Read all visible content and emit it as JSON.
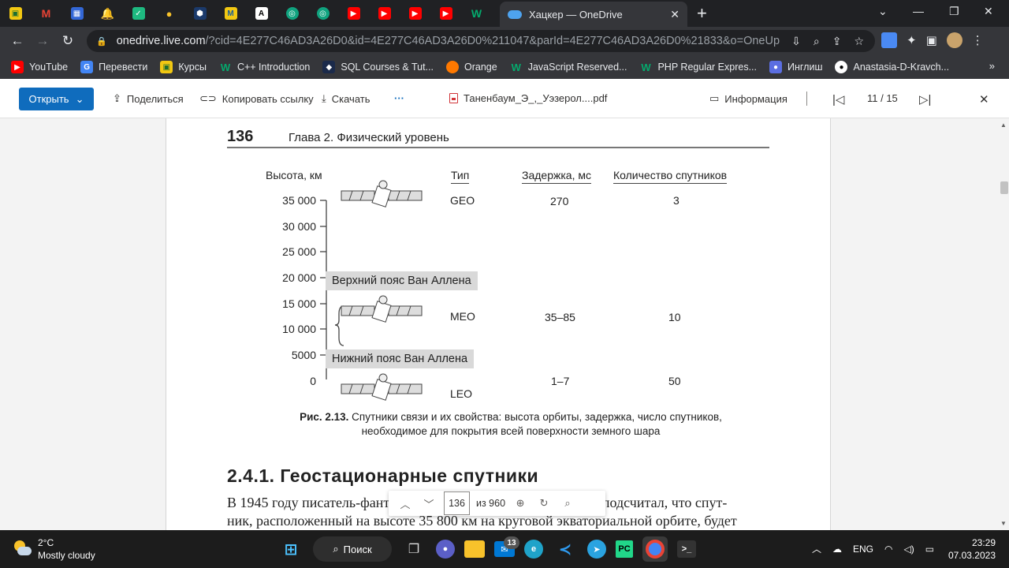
{
  "browser": {
    "active_tab_title": "Хацкер — OneDrive",
    "url_host": "onedrive.live.com",
    "url_path": "/?cid=4E277C46AD3A26D0&id=4E277C46AD3A26D0%211047&parId=4E277C46AD3A26D0%21833&o=OneUp",
    "bookmarks": [
      {
        "label": "YouTube",
        "color": "#ff0000"
      },
      {
        "label": "Перевести",
        "color": "#4285f4"
      },
      {
        "label": "Курсы",
        "color": "#f2c812"
      },
      {
        "label": "C++ Introduction",
        "color": "#04aa6d"
      },
      {
        "label": "SQL Courses & Tut...",
        "color": "#1b2a4a"
      },
      {
        "label": "Orange",
        "color": "#ff7900"
      },
      {
        "label": "JavaScript Reserved...",
        "color": "#04aa6d"
      },
      {
        "label": "PHP Regular Expres...",
        "color": "#04aa6d"
      },
      {
        "label": "Инглиш",
        "color": "#5b6ee1"
      },
      {
        "label": "Anastasia-D-Kravch...",
        "color": "#ffffff"
      }
    ],
    "bookmarks_more": "»"
  },
  "onedrive": {
    "open_label": "Открыть",
    "share_label": "Поделиться",
    "copy_link_label": "Копировать ссылку",
    "download_label": "Скачать",
    "more_label": "···",
    "file_name": "Таненбаум_Э_,_Уэзерол....pdf",
    "info_label": "Информация",
    "page_counter": "11 / 15"
  },
  "pdf": {
    "page_number": "136",
    "running_head": "Глава 2. Физический уровень",
    "figure": {
      "altitude_header": "Высота, км",
      "type_header": "Тип",
      "delay_header": "Задержка, мс",
      "count_header": "Количество спутников",
      "altitude_ticks": [
        "35 000",
        "30 000",
        "25 000",
        "20 000",
        "15 000",
        "10 000",
        "5000",
        "0"
      ],
      "upper_belt": "Верхний пояс Ван Аллена",
      "lower_belt": "Нижний пояс Ван Аллена",
      "rows": [
        {
          "type": "GEO",
          "delay": "270",
          "count": "3"
        },
        {
          "type": "MEO",
          "delay": "35–85",
          "count": "10"
        },
        {
          "type": "LEO",
          "delay": "1–7",
          "count": "50"
        }
      ]
    },
    "caption_prefix": "Рис. 2.13.",
    "caption_line1": "Спутники связи и их свойства: высота орбиты, задержка, число спутников,",
    "caption_line2": "необходимое для покрытия всей поверхности земного шара",
    "section_title": "2.4.1. Геостационарные спутники",
    "body_line1": "В 1945 году писатель-фантаст Артур Кларк (Arthur C. Clarke) подсчитал, что спут-",
    "body_line2": "ник, расположенный на высоте 35 800 км на круговой экваториальной орбите, будет"
  },
  "page_control": {
    "current_page": "136",
    "total": "из 960"
  },
  "taskbar": {
    "temperature": "2°C",
    "weather": "Mostly cloudy",
    "search_label": "Поиск",
    "mail_badge": "13",
    "language": "ENG",
    "time": "23:29",
    "date": "07.03.2023"
  }
}
